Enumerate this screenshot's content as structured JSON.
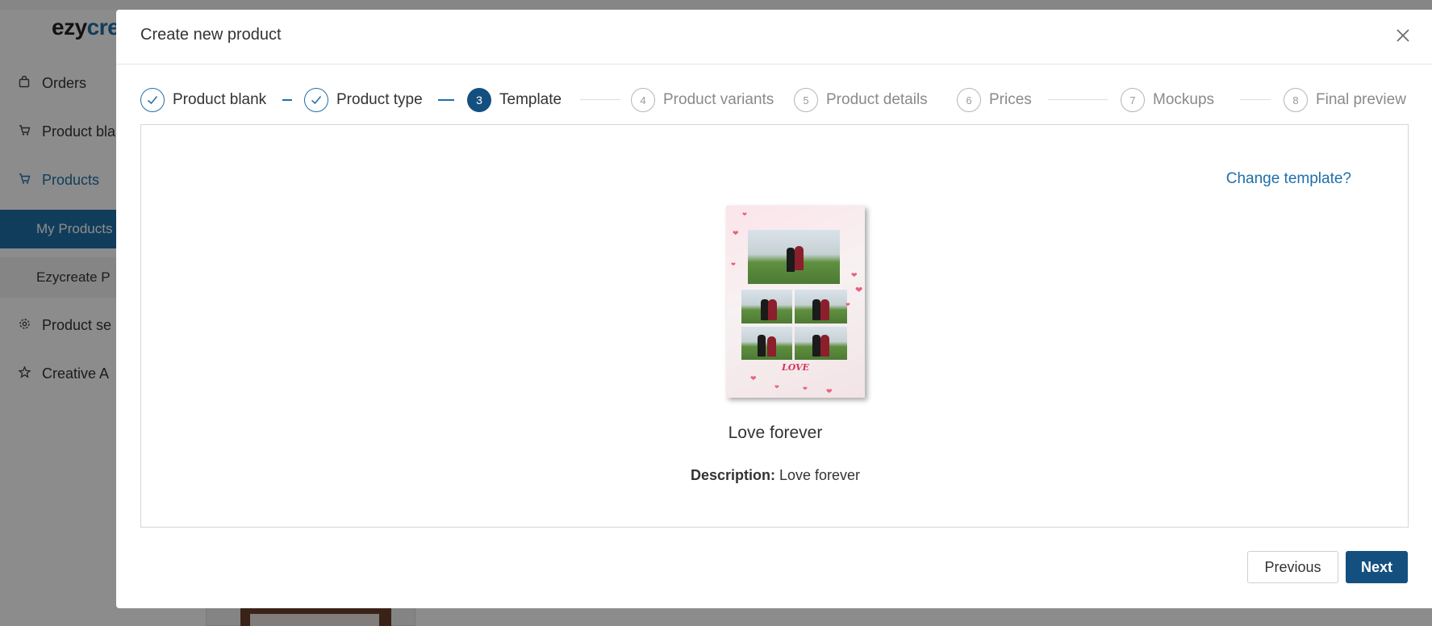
{
  "app": {
    "logo_part1": "ezy",
    "logo_part2": "cre",
    "sidebar": {
      "items": [
        {
          "label": "Orders",
          "icon": "bag-icon"
        },
        {
          "label": "Product bla",
          "icon": "cart-icon"
        },
        {
          "label": "Products",
          "icon": "cart-icon"
        },
        {
          "label": "Product se",
          "icon": "gear-icon"
        },
        {
          "label": "Creative A",
          "icon": "star-icon"
        }
      ],
      "subitems": [
        {
          "label": "My Products"
        },
        {
          "label": "Ezycreate P"
        }
      ]
    }
  },
  "modal": {
    "title": "Create new product",
    "steps": [
      {
        "number": "1",
        "label": "Product blank",
        "state": "done"
      },
      {
        "number": "2",
        "label": "Product type",
        "state": "done"
      },
      {
        "number": "3",
        "label": "Template",
        "state": "current"
      },
      {
        "number": "4",
        "label": "Product variants",
        "state": "pending"
      },
      {
        "number": "5",
        "label": "Product details",
        "state": "pending"
      },
      {
        "number": "6",
        "label": "Prices",
        "state": "pending"
      },
      {
        "number": "7",
        "label": "Mockups",
        "state": "pending"
      },
      {
        "number": "8",
        "label": "Final preview",
        "state": "pending"
      }
    ],
    "change_template_link": "Change template?",
    "template": {
      "love_text": "LOVE",
      "name": "Love forever",
      "description_label": "Description:",
      "description_value": "Love forever"
    },
    "buttons": {
      "previous": "Previous",
      "next": "Next"
    }
  },
  "colors": {
    "primary": "#14507f",
    "link": "#1f6fa8",
    "border": "#d6d6d6"
  }
}
